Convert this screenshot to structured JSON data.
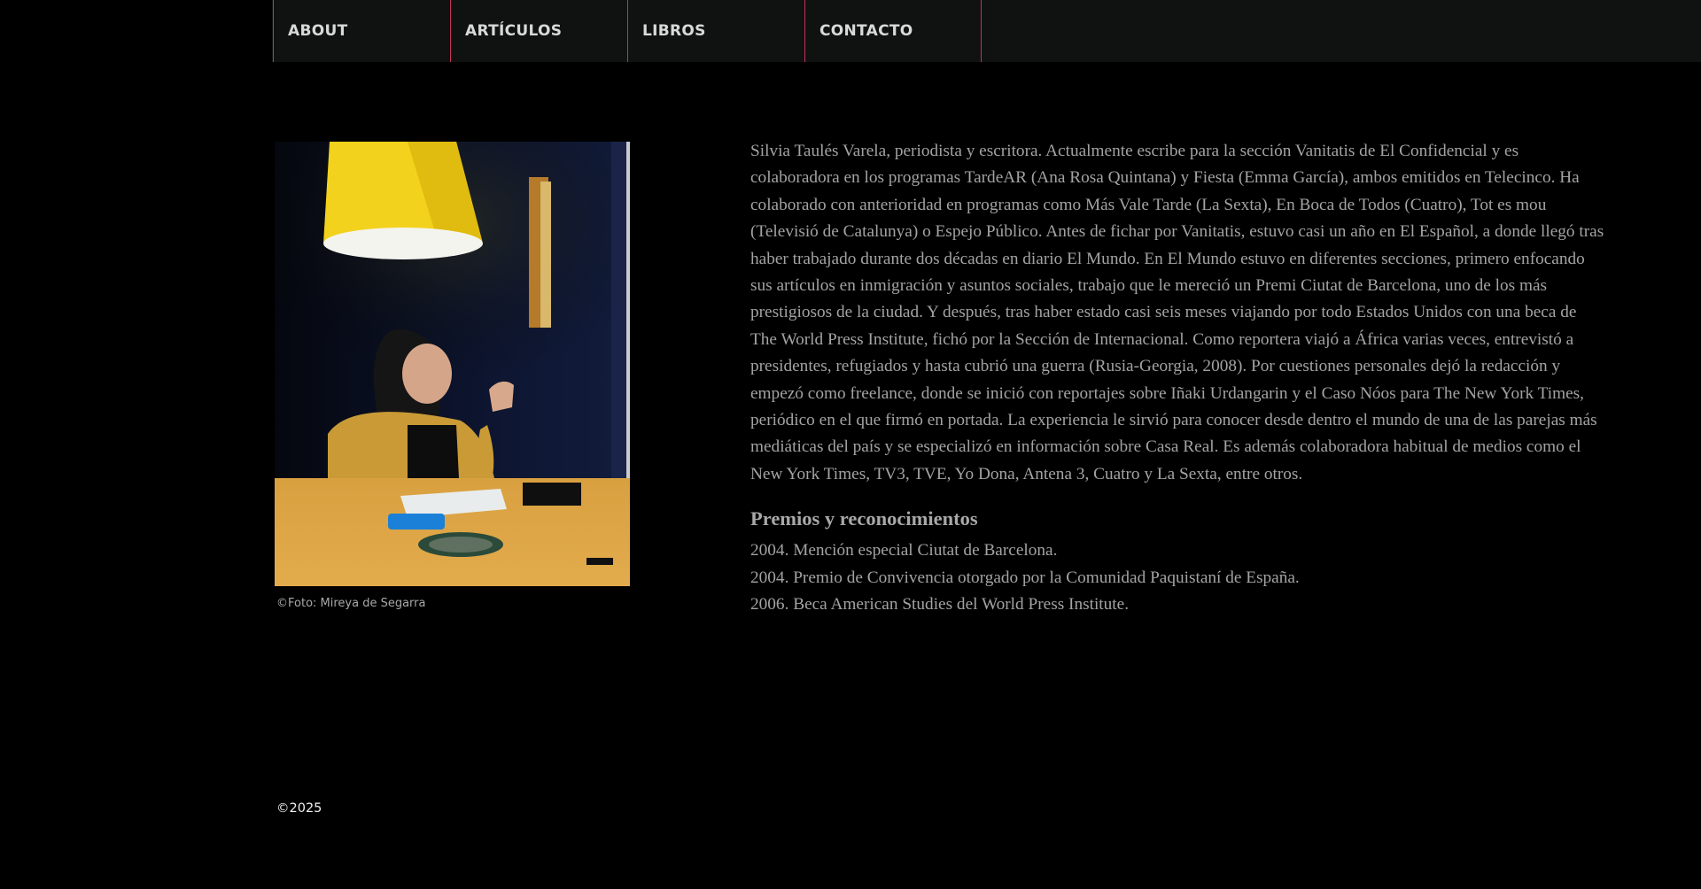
{
  "nav": {
    "items": [
      {
        "label": "ABOUT"
      },
      {
        "label": "ARTÍCULOS"
      },
      {
        "label": "LIBROS"
      },
      {
        "label": "CONTACTO"
      }
    ]
  },
  "photo": {
    "caption": "©Foto: Mireya de Segarra"
  },
  "bio": {
    "text": "Silvia Taulés Varela, periodista y escritora. Actualmente escribe para la sección Vanitatis de El Confidencial y es colaboradora en los programas TardeAR (Ana Rosa Quintana) y Fiesta (Emma García), ambos emitidos en Telecinco. Ha colaborado con anterioridad en programas como Más Vale Tarde (La Sexta), En Boca de Todos (Cuatro), Tot es mou (Televisió de Catalunya) o Espejo Público. Antes de fichar por Vanitatis, estuvo casi un año en El Español, a donde llegó tras haber trabajado durante dos décadas en diario El Mundo. En El Mundo estuvo en diferentes secciones, primero enfocando sus artículos en inmigración y asuntos sociales, trabajo que le mereció un Premi Ciutat de Barcelona, uno de los más prestigiosos de la ciudad. Y después, tras haber estado casi seis meses viajando por todo Estados Unidos con una beca de The World Press Institute, fichó por la Sección de Internacional. Como reportera viajó a África varias veces, entrevistó a presidentes, refugiados y hasta cubrió una guerra (Rusia-Georgia, 2008). Por cuestiones personales dejó la redacción y empezó como freelance, donde se inició con reportajes sobre Iñaki Urdangarin y el Caso Nóos para The New York Times, periódico en el que firmó en portada. La experiencia le sirvió para conocer desde dentro el mundo de una de las parejas más mediáticas del país y se especializó en información sobre Casa Real. Es además colaboradora habitual de medios como el New York Times, TV3, TVE, Yo Dona, Antena 3, Cuatro y La Sexta, entre otros."
  },
  "awards": {
    "heading": "Premios y reconocimientos",
    "items": [
      "2004. Mención especial Ciutat de Barcelona.",
      "2004. Premio de Convivencia otorgado por la Comunidad Paquistaní de España.",
      "2006. Beca American Studies del World Press Institute."
    ]
  },
  "footer": {
    "copyright": "©2025"
  },
  "colors": {
    "background": "#000000",
    "navbar": "#101111",
    "nav_divider": "#c2345a",
    "nav_text": "#d9d9d9",
    "body_text": "#a3a3a3"
  }
}
